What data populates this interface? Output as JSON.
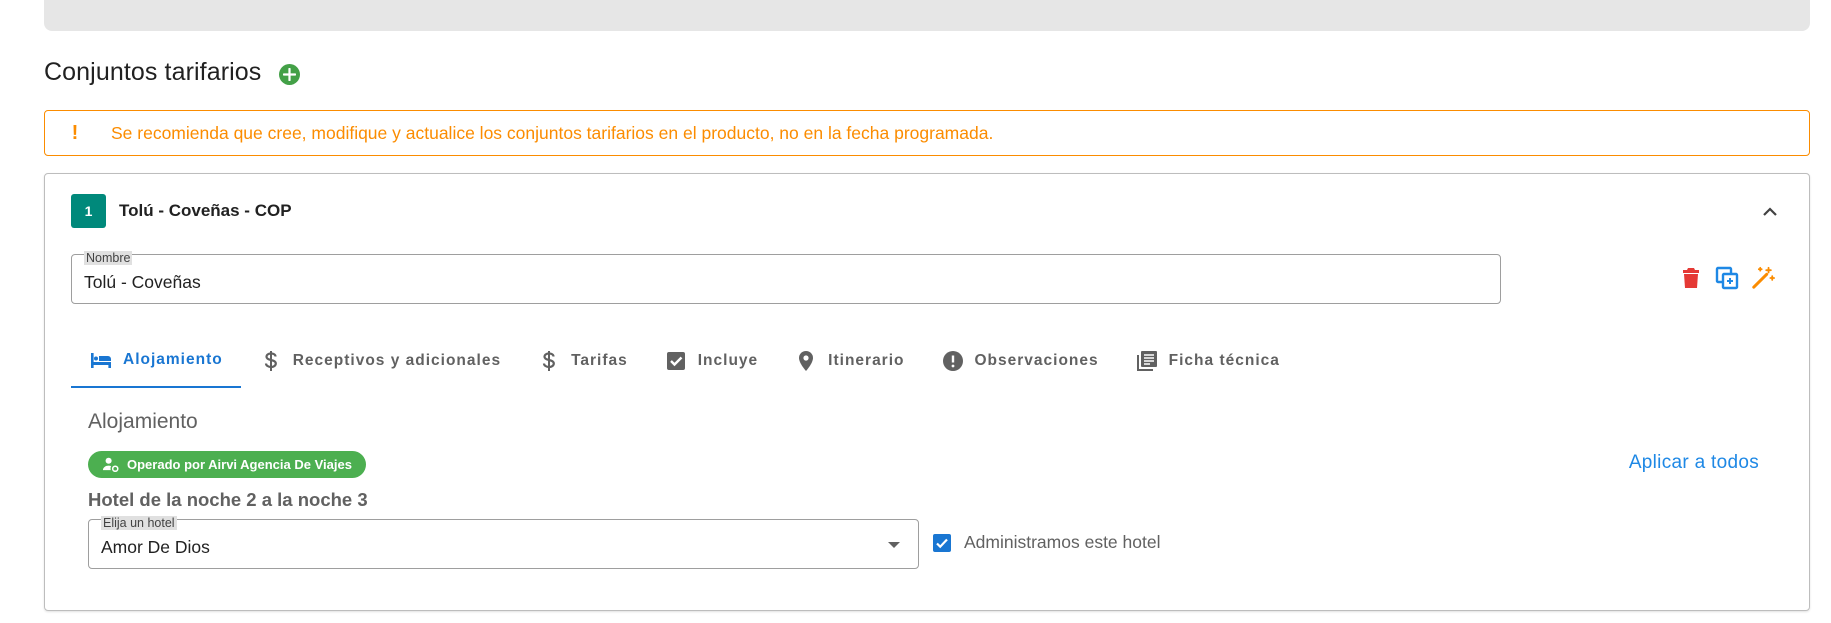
{
  "section": {
    "title": "Conjuntos tarifarios"
  },
  "alert": {
    "icon": "!",
    "text": "Se recomienda que cree, modifique y actualice los conjuntos tarifarios en el producto, no en la fecha programada."
  },
  "panel": {
    "number": "1",
    "title": "Tolú - Coveñas - COP",
    "name_field": {
      "label": "Nombre",
      "value": "Tolú - Coveñas"
    },
    "action_icons": [
      "trash-icon",
      "copy-icon",
      "magic-wand-icon"
    ],
    "tabs": [
      {
        "label": "Alojamiento",
        "icon": "bed-icon",
        "active": true
      },
      {
        "label": "Receptivos y adicionales",
        "icon": "dollar-icon"
      },
      {
        "label": "Tarifas",
        "icon": "dollar-icon"
      },
      {
        "label": "Incluye",
        "icon": "checkbox-icon"
      },
      {
        "label": "Itinerario",
        "icon": "map-pin-icon"
      },
      {
        "label": "Observaciones",
        "icon": "exclamation-circle-icon"
      },
      {
        "label": "Ficha técnica",
        "icon": "library-books-icon"
      }
    ],
    "content": {
      "title": "Alojamiento",
      "operator_chip": "Operado por Airvi Agencia De Viajes",
      "apply_all": "Aplicar a todos",
      "night_title": "Hotel de la noche 2 a la noche 3",
      "hotel_select": {
        "label": "Elija un hotel",
        "value": "Amor De Dios"
      },
      "managed_checkbox": {
        "label": "Administramos este hotel",
        "checked": true
      }
    }
  },
  "colors": {
    "accent": "#1976d2",
    "success": "#43a047",
    "warning": "#fb8c00",
    "danger": "#e53935",
    "badge": "#00897b"
  }
}
